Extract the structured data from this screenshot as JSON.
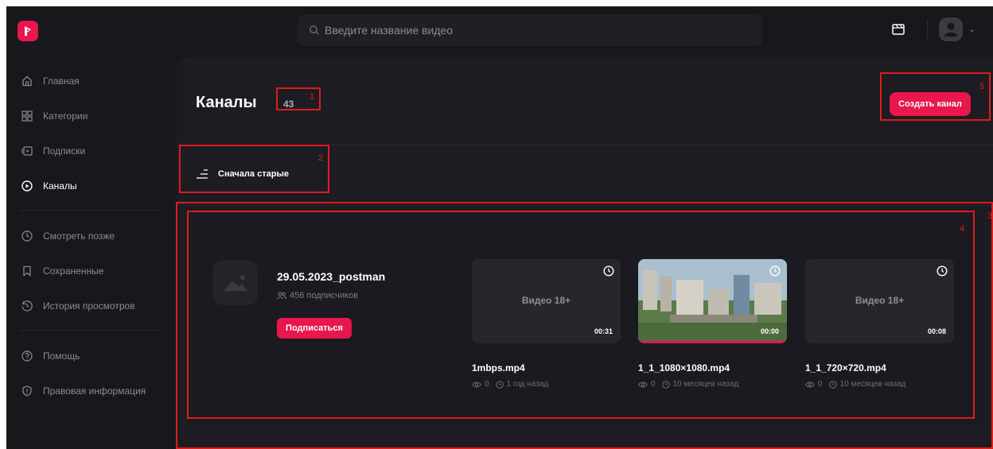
{
  "header": {
    "search_placeholder": "Введите название видео",
    "icons": [
      "logo-icon",
      "search-icon",
      "studio-icon",
      "avatar-icon",
      "chevron-down-icon"
    ]
  },
  "sidebar": {
    "items": [
      {
        "label": "Главная",
        "icon": "home-icon"
      },
      {
        "label": "Категории",
        "icon": "categories-icon"
      },
      {
        "label": "Подписки",
        "icon": "subscriptions-icon"
      },
      {
        "label": "Каналы",
        "icon": "channels-icon",
        "active": true
      },
      {
        "label": "Смотреть позже",
        "icon": "clock-icon"
      },
      {
        "label": "Сохраненные",
        "icon": "bookmark-icon"
      },
      {
        "label": "История просмотров",
        "icon": "history-icon"
      },
      {
        "label": "Помощь",
        "icon": "help-icon"
      },
      {
        "label": "Правовая информация",
        "icon": "shield-icon"
      }
    ]
  },
  "page": {
    "title": "Каналы",
    "count": "43",
    "create_button": "Создать канал",
    "sort_label": "Сначала старые"
  },
  "channel": {
    "name": "29.05.2023_postman",
    "subscribers": "456 подписчиков",
    "subscribe_button": "Подписаться",
    "videos": [
      {
        "thumb_label": "Видео 18+",
        "duration": "00:31",
        "title": "1mbps.mp4",
        "views": "0",
        "date": "1 год назад",
        "progress": 0
      },
      {
        "thumb_label": "",
        "duration": "00:00",
        "title": "1_1_1080×1080.mp4",
        "views": "0",
        "date": "10 месяцев назад",
        "progress": 1.0
      },
      {
        "thumb_label": "Видео 18+",
        "duration": "00:08",
        "title": "1_1_720×720.mp4",
        "views": "0",
        "date": "10 месяцев назад",
        "progress": 0
      }
    ]
  },
  "annotations": [
    "1",
    "2",
    "3",
    "4",
    "5"
  ],
  "colors": {
    "accent": "#e8174d",
    "background": "#17171c",
    "panel": "#1c1c22",
    "annotation": "#e01b1b"
  }
}
